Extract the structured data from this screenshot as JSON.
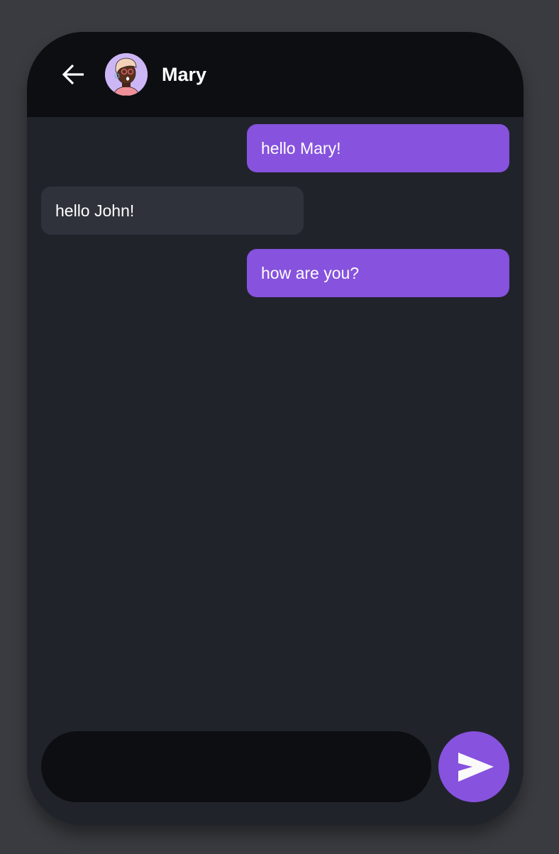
{
  "header": {
    "contact_name": "Mary",
    "back_icon": "arrow-left-icon",
    "avatar": "contact-avatar"
  },
  "messages": [
    {
      "from": "me",
      "text": "hello Mary!"
    },
    {
      "from": "contact",
      "text": "hello John!"
    },
    {
      "from": "me",
      "text": "how are you?"
    }
  ],
  "composer": {
    "value": "",
    "send_icon": "send-icon"
  },
  "colors": {
    "accent": "#8652de",
    "header": "#0d0e12",
    "body": "#21232b",
    "received_bubble": "#2f323b",
    "background": "#3a3b40"
  }
}
